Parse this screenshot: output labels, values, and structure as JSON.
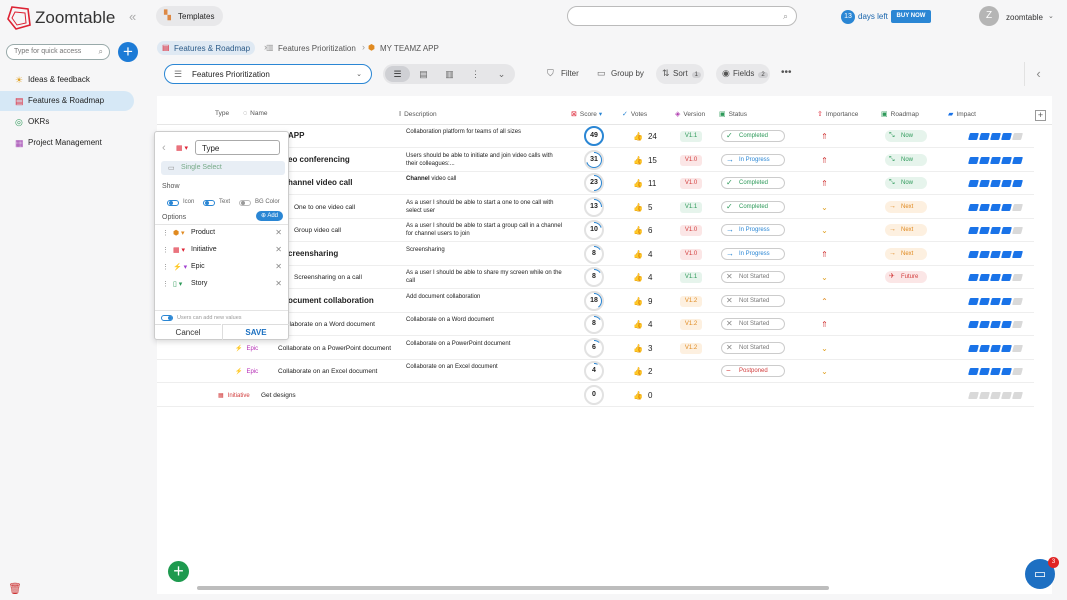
{
  "app": {
    "brand": "Zoomtable",
    "quick_access_placeholder": "Type for quick access"
  },
  "sidebar": {
    "items": [
      {
        "label": "Ideas & feedback",
        "icon": "bulb-icon"
      },
      {
        "label": "Features & Roadmap",
        "icon": "roadmap-icon"
      },
      {
        "label": "OKRs",
        "icon": "okr-icon"
      },
      {
        "label": "Project Management",
        "icon": "project-icon"
      }
    ]
  },
  "topbar": {
    "templates": "Templates",
    "trial_days": "13",
    "days_left": "days left",
    "buy_now": "BUY NOW",
    "user_initial": "Z",
    "username": "zoomtable"
  },
  "breadcrumbs": [
    "Features & Roadmap",
    "Features Prioritization",
    "MY TEAMZ APP"
  ],
  "toolbar": {
    "view": "Features Prioritization",
    "filter": "Filter",
    "group_by": "Group by",
    "sort": "Sort",
    "sort_count": "1",
    "fields": "Fields",
    "fields_count": "2"
  },
  "columns": {
    "type": "Type",
    "name": "Name",
    "description": "Description",
    "score": "Score",
    "votes": "Votes",
    "version": "Version",
    "status": "Status",
    "importance": "Importance",
    "roadmap": "Roadmap",
    "impact": "Impact"
  },
  "rows": [
    {
      "name": "APP",
      "desc": "Collaboration platform for teams of all sizes",
      "score": "49",
      "votes": "24",
      "version": "V1.1",
      "status": "Completed",
      "roadmap": "Now",
      "impact": 4
    },
    {
      "name": "eo conferencing",
      "desc": "Users should be able to initiate and join video calls with their colleagues:...",
      "score": "31",
      "votes": "15",
      "version": "V1.0",
      "status": "In Progress",
      "roadmap": "Now",
      "impact": 5
    },
    {
      "name": "hannel video call",
      "desc_bold": "Channel",
      "desc": "video call",
      "score": "23",
      "votes": "11",
      "version": "V1.0",
      "status": "Completed",
      "roadmap": "Now",
      "impact": 5
    },
    {
      "name": "One to one video call",
      "desc": "As a user I should be able to start a one to one call with select user",
      "score": "13",
      "votes": "5",
      "version": "V1.1",
      "status": "Completed",
      "roadmap": "Next",
      "impact": 4
    },
    {
      "name": "Group video call",
      "desc": "As a user I should be able to start a group call in a channel for channel users to join",
      "score": "10",
      "votes": "6",
      "version": "V1.0",
      "status": "In Progress",
      "roadmap": "Next",
      "impact": 4
    },
    {
      "name": "creensharing",
      "desc": "Screensharing",
      "score": "8",
      "votes": "4",
      "version": "V1.0",
      "status": "In Progress",
      "roadmap": "Next",
      "impact": 5
    },
    {
      "name": "Screensharing on a call",
      "desc": "As a user I should be able to share my screen while on the call",
      "score": "8",
      "votes": "4",
      "version": "V1.1",
      "status": "Not Started",
      "roadmap": "Future",
      "impact": 4
    },
    {
      "name": "ocument collaboration",
      "desc": "Add document collaboration",
      "score": "18",
      "votes": "9",
      "version": "V1.2",
      "status": "Not Started",
      "roadmap": "",
      "impact": 4
    },
    {
      "name": "llaborate on a Word document",
      "desc": "Collaborate on a Word document",
      "score": "8",
      "votes": "4",
      "version": "V1.2",
      "status": "Not Started",
      "roadmap": "",
      "impact": 4
    },
    {
      "type": "Epic",
      "name": "Collaborate on a PowerPoint document",
      "desc": "Collaborate on a PowerPoint document",
      "score": "6",
      "votes": "3",
      "version": "V1.2",
      "status": "Not Started",
      "roadmap": "",
      "impact": 4
    },
    {
      "type": "Epic",
      "name": "Collaborate on an Excel document",
      "desc": "Collaborate on an Excel document",
      "score": "4",
      "votes": "2",
      "version": "",
      "status": "Postponed",
      "roadmap": "",
      "impact": 4
    },
    {
      "type": "Initiative",
      "name": "Get designs",
      "desc": "",
      "score": "0",
      "votes": "0",
      "version": "",
      "status": "",
      "roadmap": "",
      "impact": 0
    }
  ],
  "popup": {
    "field_name": "Type",
    "field_kind": "Single Select",
    "show_label": "Show",
    "show_icon": "Icon",
    "show_text": "Text",
    "show_bg": "BG Color",
    "options_label": "Options",
    "add_label": "Add",
    "options": [
      "Product",
      "Initiative",
      "Epic",
      "Story"
    ],
    "note": "Users can add new values",
    "cancel": "Cancel",
    "save": "SAVE"
  },
  "chat_badge": "3",
  "colors": {
    "accent": "#2a86d4",
    "completed": "#2e9a5a",
    "in_progress": "#2a86d4",
    "postponed": "#d23c3c",
    "impact": "#1a73e8"
  }
}
